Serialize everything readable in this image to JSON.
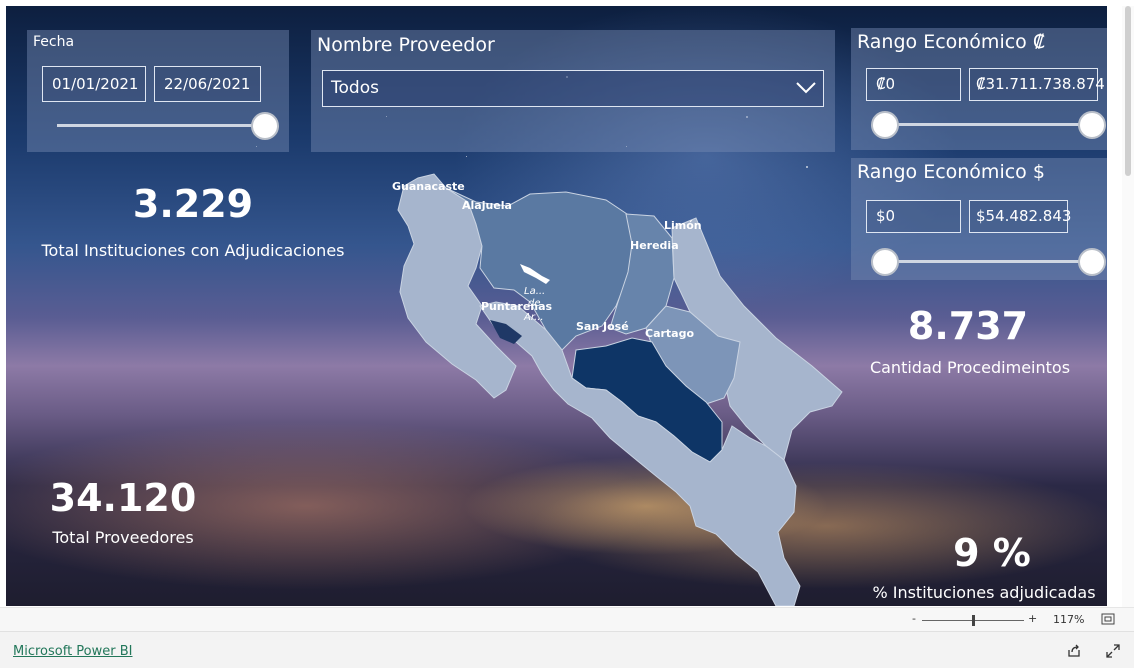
{
  "filters": {
    "fecha": {
      "title": "Fecha",
      "start": "01/01/2021",
      "end": "22/06/2021"
    },
    "proveedor": {
      "title": "Nombre Proveedor",
      "selected": "Todos"
    },
    "rango_colones": {
      "title": "Rango Económico ₡",
      "min": "₡0",
      "max": "₡31.711.738.874"
    },
    "rango_dolares": {
      "title": "Rango Económico $",
      "min": "$0",
      "max": "$54.482.843"
    }
  },
  "kpis": {
    "instituciones": {
      "value": "3.229",
      "label": "Total Instituciones con Adjudicaciones"
    },
    "proveedores": {
      "value": "34.120",
      "label": "Total Proveedores"
    },
    "procedimientos": {
      "value": "8.737",
      "label": "Cantidad Procedimeintos"
    },
    "porcentaje": {
      "value": "9 %",
      "label": "% Instituciones adjudicadas"
    }
  },
  "map": {
    "provinces": [
      "Guanacaste",
      "Alajuela",
      "Limón",
      "Heredia",
      "Puntarenas",
      "San José",
      "Cartago"
    ],
    "lake_label_lines": [
      "La...",
      "de",
      "Ar..."
    ]
  },
  "zoom": {
    "minus": "-",
    "plus": "+",
    "level": "117%"
  },
  "footer": {
    "link": "Microsoft Power BI"
  },
  "colors": {
    "map_light": "#a3b3cc",
    "map_mid": "#5b7aa3",
    "map_dark": "#0e3566",
    "panel": "#7f94c0"
  },
  "icons": {
    "dropdown": "chevron-down-icon",
    "fit": "fit-to-page-icon",
    "share": "share-icon",
    "fullscreen": "fullscreen-icon"
  }
}
